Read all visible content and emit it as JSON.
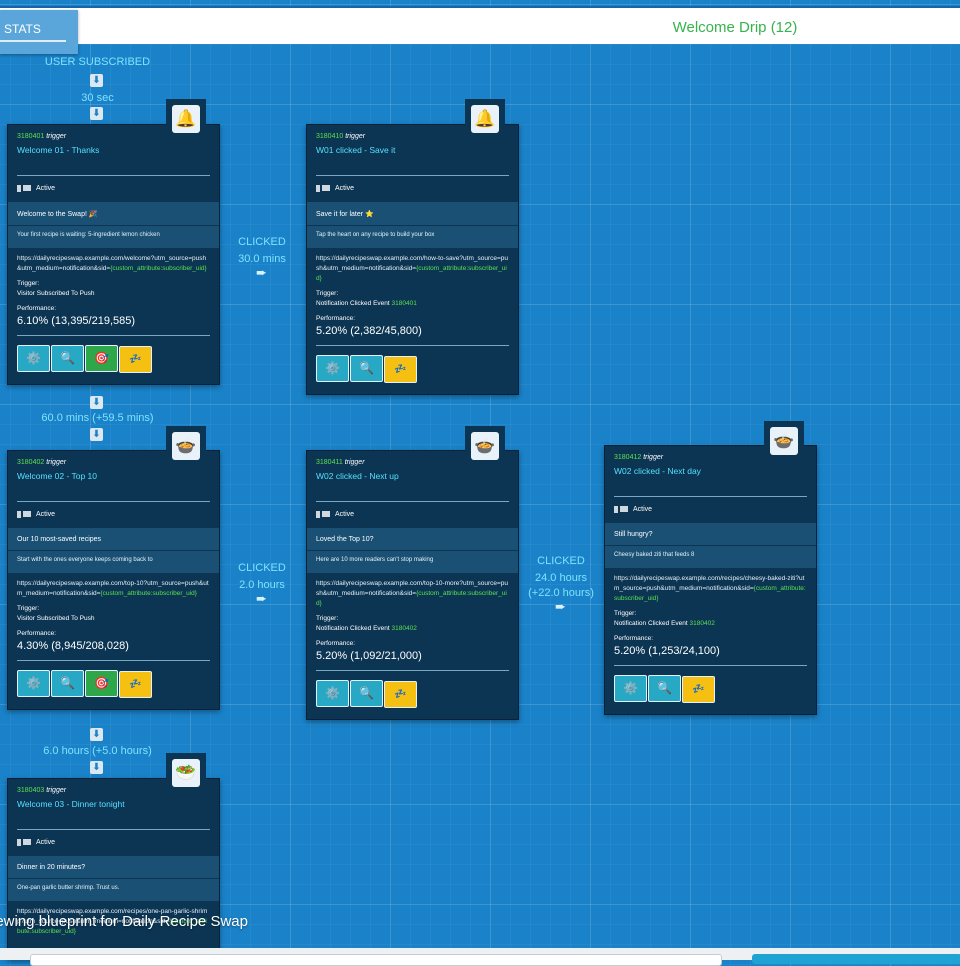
{
  "header": {
    "stats_label": "STATS",
    "drip_title": "Welcome Drip (12)"
  },
  "flow": {
    "start": "USER SUBSCRIBED",
    "start_delay": "30 sec",
    "col1_delay_1": "60.0 mins (+59.5 mins)",
    "col1_delay_2": "6.0 hours (+5.0 hours)",
    "click_1": {
      "label": "CLICKED",
      "delay": "30.0 mins"
    },
    "click_2": {
      "label": "CLICKED",
      "delay": "2.0 hours"
    },
    "click_3": {
      "label": "CLICKED",
      "delay": "24.0 hours",
      "extra": "(+22.0 hours)"
    },
    "down_arrow": "⬇",
    "right_arrow": "➨"
  },
  "common": {
    "trigger_word": "trigger",
    "status": "Active",
    "trigger_label": "Trigger:",
    "performance_label": "Performance:",
    "url_attr": "{custom_attribute:subscriber_uid}",
    "gear_icon": "⚙️",
    "search_icon": "🔍",
    "target_icon": "🎯",
    "sleep_icon": "💤"
  },
  "cards": [
    {
      "id": "3180401",
      "name": "Welcome 01 - Thanks",
      "icon": "bell-icon",
      "glyph": "🔔",
      "title": "Welcome to the Swap! 🎉",
      "body": "Your first recipe is waiting: 5-ingredient lemon chicken",
      "url": "https://dailyrecipeswap.example.com/welcome?utm_source=push&utm_medium=notification&sid=",
      "trigger": "Visitor Subscribed To Push",
      "trigger_event": "",
      "performance": "6.10% (13,395/219,585)"
    },
    {
      "id": "3180410",
      "name": "W01 clicked - Save it",
      "icon": "bell-icon",
      "glyph": "🔔",
      "title": "Save it for later ⭐",
      "body": "Tap the heart on any recipe to build your box",
      "url": "https://dailyrecipeswap.example.com/how-to-save?utm_source=push&utm_medium=notification&sid=",
      "trigger": "Notification Clicked Event ",
      "trigger_event": "3180401",
      "performance": "5.20% (2,382/45,800)"
    },
    {
      "id": "3180402",
      "name": "Welcome 02 - Top 10",
      "icon": "pot-of-food-icon",
      "glyph": "🍲",
      "title": "Our 10 most-saved recipes",
      "body": "Start with the ones everyone keeps coming back to",
      "url": "https://dailyrecipeswap.example.com/top-10?utm_source=push&utm_medium=notification&sid=",
      "trigger": "Visitor Subscribed To Push",
      "trigger_event": "",
      "performance": "4.30% (8,945/208,028)"
    },
    {
      "id": "3180411",
      "name": "W02 clicked - Next up",
      "icon": "pot-of-food-icon",
      "glyph": "🍲",
      "title": "Loved the Top 10?",
      "body": "Here are 10 more readers can't stop making",
      "url": "https://dailyrecipeswap.example.com/top-10-more?utm_source=push&utm_medium=notification&sid=",
      "trigger": "Notification Clicked Event ",
      "trigger_event": "3180402",
      "performance": "5.20% (1,092/21,000)"
    },
    {
      "id": "3180412",
      "name": "W02 clicked - Next day",
      "icon": "pot-of-food-icon",
      "glyph": "🍲",
      "title": "Still hungry?",
      "body": "Cheesy baked ziti that feeds 8",
      "url": "https://dailyrecipeswap.example.com/recipes/cheesy-baked-ziti?utm_source=push&utm_medium=notification&sid=",
      "trigger": "Notification Clicked Event ",
      "trigger_event": "3180402",
      "performance": "5.20% (1,253/24,100)"
    },
    {
      "id": "3180403",
      "name": "Welcome 03 - Dinner tonight",
      "icon": "salad-icon",
      "glyph": "🥗",
      "title": "Dinner in 20 minutes?",
      "body": "One-pan garlic butter shrimp. Trust us.",
      "url": "https://dailyrecipeswap.example.com/recipes/one-pan-garlic-shrimp?utm_source=push&utm_medium=notification&sid=",
      "trigger": "",
      "trigger_event": "",
      "performance": ""
    }
  ],
  "footer": {
    "status_text": "iewing blueprint for Daily Recipe Swap"
  }
}
